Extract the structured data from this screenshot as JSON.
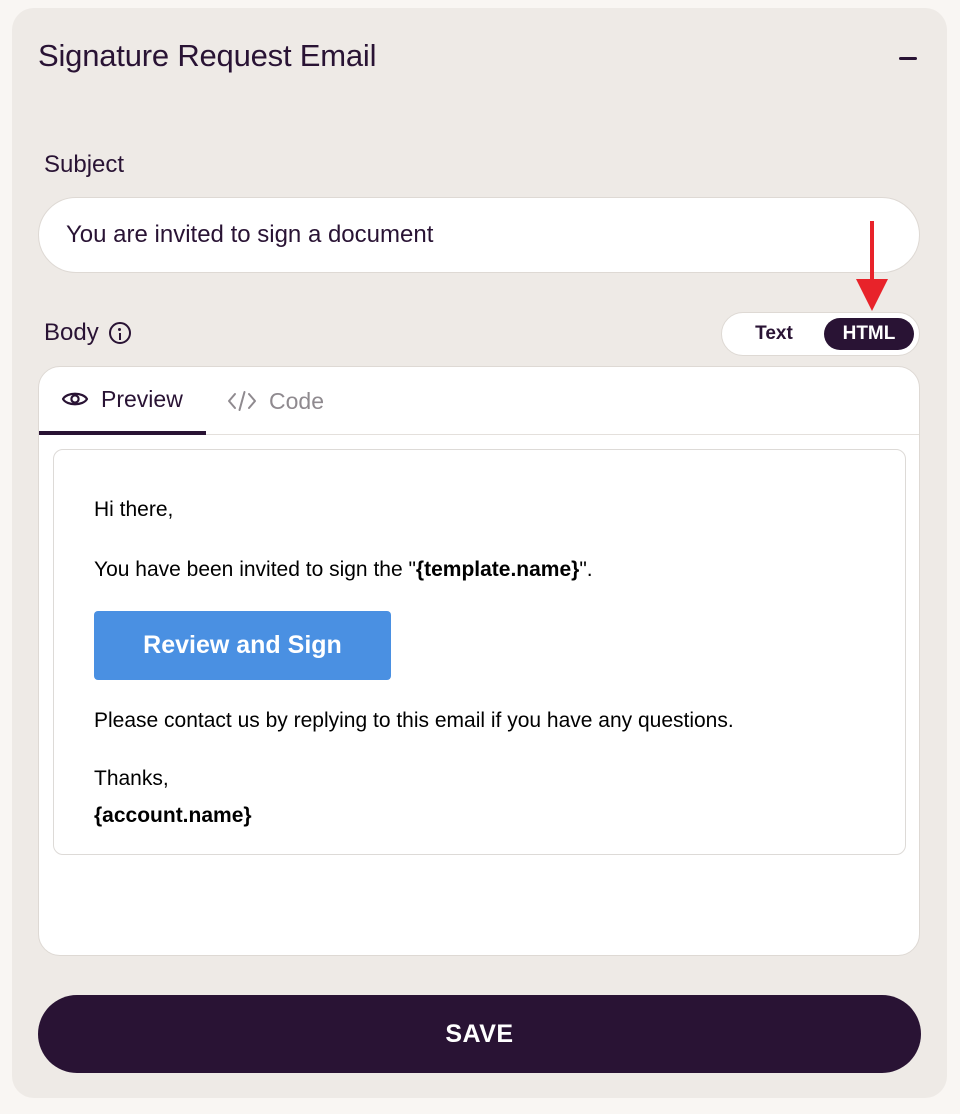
{
  "card": {
    "title": "Signature Request Email"
  },
  "subject": {
    "label": "Subject",
    "value": "You are invited to sign a document"
  },
  "body": {
    "label": "Body",
    "format_toggle": {
      "text_label": "Text",
      "html_label": "HTML",
      "selected": "HTML"
    },
    "tabs": [
      {
        "label": "Preview",
        "icon": "eye-icon",
        "active": true
      },
      {
        "label": "Code",
        "icon": "code-icon",
        "active": false
      }
    ],
    "preview": {
      "greeting": "Hi there,",
      "invite_prefix": "You have been invited to sign the \"",
      "invite_variable": "{template.name}",
      "invite_suffix": "\".",
      "button_label": "Review and Sign",
      "contact": "Please contact us by replying to this email if you have any questions.",
      "thanks": "Thanks,",
      "account_variable": "{account.name}"
    }
  },
  "save_label": "SAVE",
  "colors": {
    "primary": "#291334",
    "card_bg": "#eeeae6",
    "button_blue": "#4a90e2",
    "annotation_arrow": "#e8232a"
  }
}
